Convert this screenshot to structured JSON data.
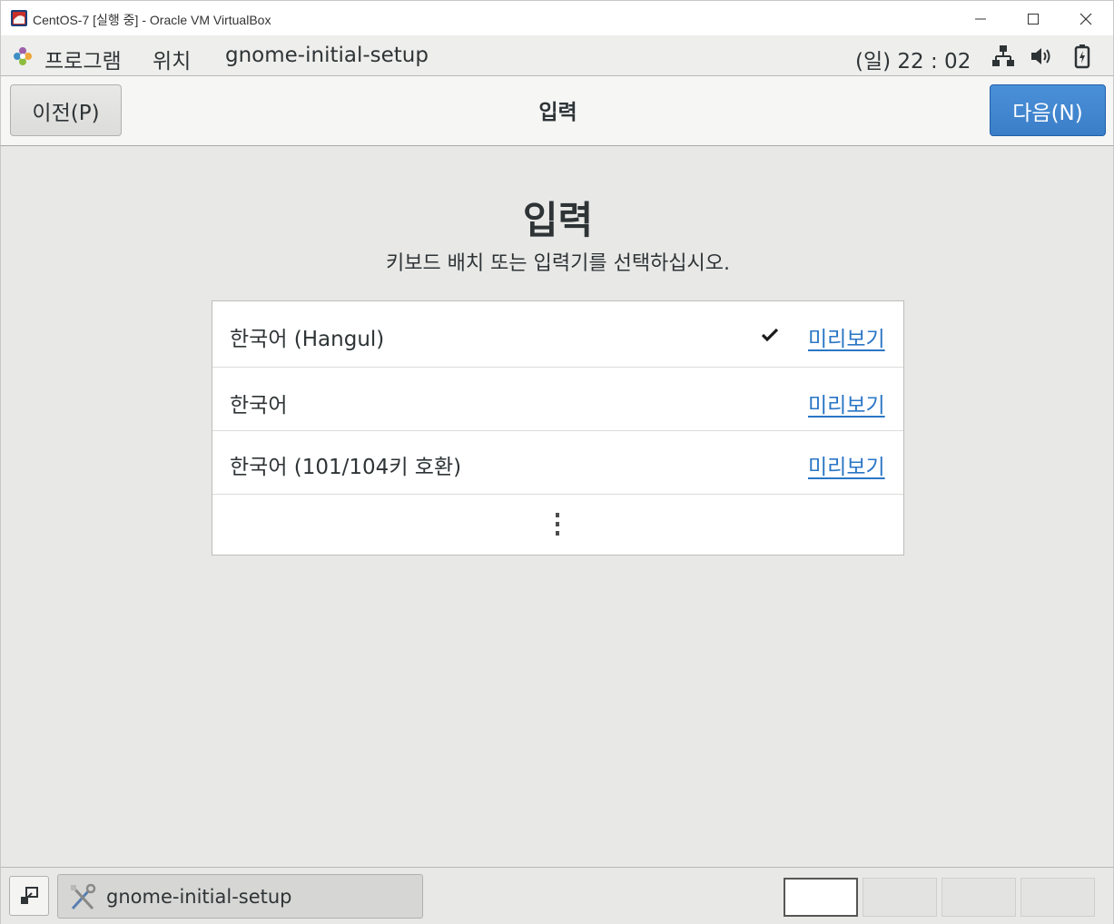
{
  "window": {
    "title": "CentOS-7 [실행 중] - Oracle VM VirtualBox",
    "icon": "virtualbox-icon",
    "controls": [
      "minimize-icon",
      "maximize-icon",
      "close-icon"
    ]
  },
  "top_panel": {
    "applications_label": "프로그램",
    "places_label": "위치",
    "app_menu_label": "gnome-initial-setup",
    "clock": "(일) 22 : 02",
    "status_icons": [
      "network-icon",
      "volume-icon",
      "battery-icon"
    ]
  },
  "headerbar": {
    "prev_label": "이전(P)",
    "title": "입력",
    "next_label": "다음(N)"
  },
  "page": {
    "heading": "입력",
    "subtitle": "키보드 배치 또는 입력기를 선택하십시오.",
    "input_sources": [
      {
        "label": "한국어 (Hangul)",
        "selected": true,
        "preview_label": "미리보기"
      },
      {
        "label": "한국어",
        "selected": false,
        "preview_label": "미리보기"
      },
      {
        "label": "한국어 (101/104키 호환)",
        "selected": false,
        "preview_label": "미리보기"
      }
    ],
    "more_icon": "more-vertical-icon"
  },
  "taskbar": {
    "task_label": "gnome-initial-setup",
    "workspaces": 4,
    "active_workspace": 1
  },
  "colors": {
    "accent": "#3b7ec8",
    "link": "#2a76c6",
    "background": "#e8e8e7"
  }
}
